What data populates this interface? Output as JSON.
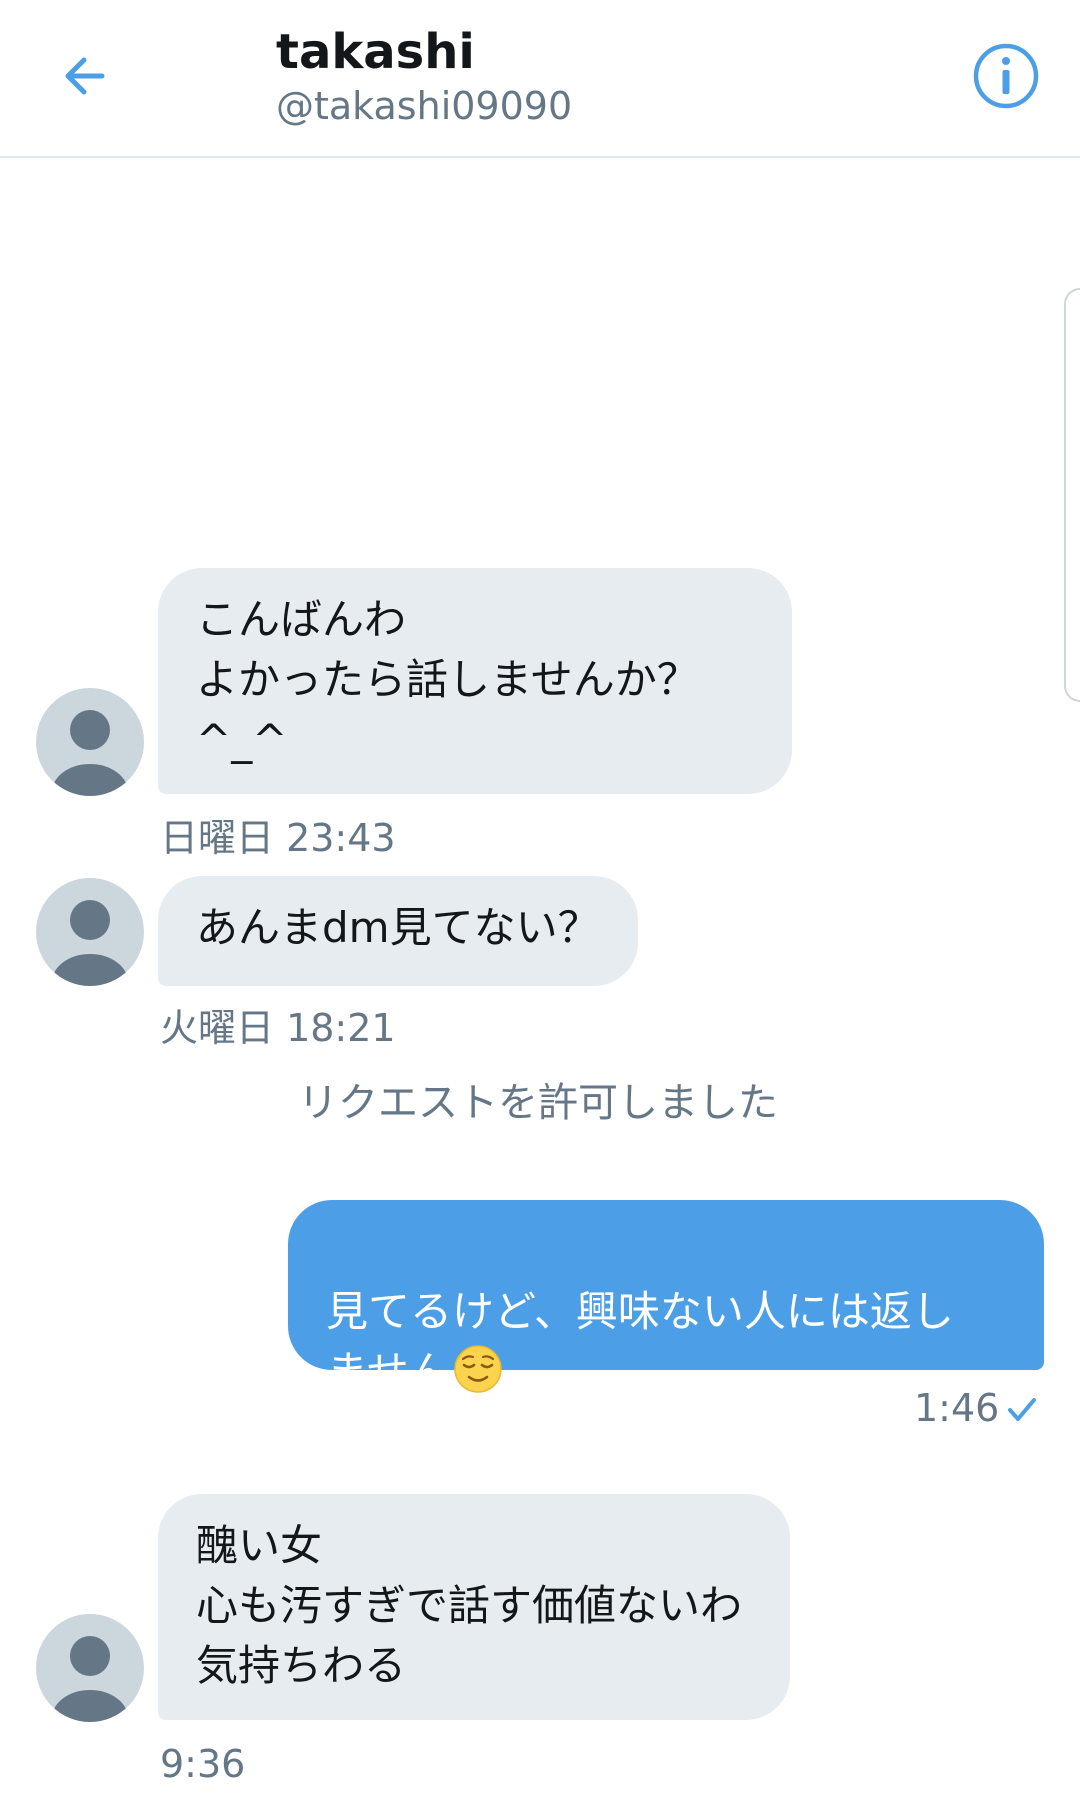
{
  "header": {
    "name": "takashi",
    "handle": "@takashi09090",
    "back_icon": "arrow-left-icon",
    "info_icon": "info-icon",
    "accent": "#4c9fe6"
  },
  "messages": [
    {
      "text": "こんばんわ\nよかったら話しませんか？\n^_^",
      "timestamp": "日曜日 23:43"
    },
    {
      "text": "あんまdm見てない？",
      "timestamp": "火曜日 18:21"
    },
    {
      "system": "リクエストを許可しました"
    },
    {
      "text": "見てるけど、興味ない人には返し\nません",
      "emoji": "relieved-face-emoji",
      "timestamp": "1:46",
      "status_icon": "check-icon"
    },
    {
      "text": "醜い女\n心も汚すぎで話す価値ないわ\n気持ちわる",
      "timestamp": "9:36"
    }
  ]
}
